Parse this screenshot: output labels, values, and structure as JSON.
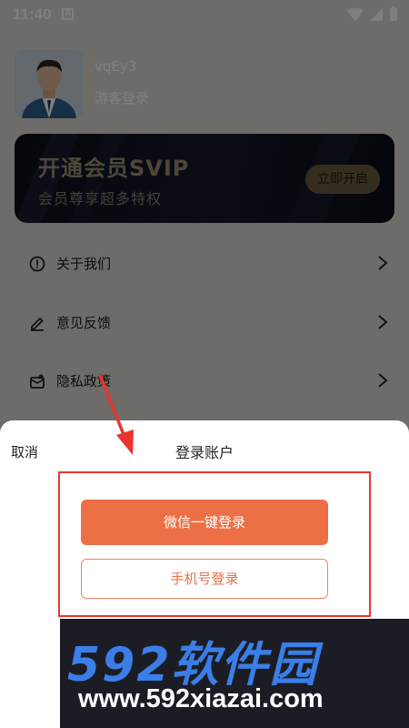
{
  "status": {
    "time": "11:40",
    "a_badge": "A"
  },
  "profile": {
    "username": "vqEy3",
    "usertype": "游客登录"
  },
  "vip": {
    "title": "开通会员SVIP",
    "subtitle": "会员尊享超多特权",
    "button": "立即开启"
  },
  "menu": [
    {
      "label": "关于我们",
      "icon": "alert-circle-icon"
    },
    {
      "label": "意见反馈",
      "icon": "edit-icon"
    },
    {
      "label": "隐私政策",
      "icon": "privacy-mail-icon"
    }
  ],
  "sheet": {
    "cancel": "取消",
    "title": "登录账户",
    "wechat_login": "微信一键登录",
    "phone_login": "手机号登录"
  },
  "watermark": {
    "brand": "592软件园",
    "url": "www.592xiazai.com"
  },
  "colors": {
    "accent": "#ed6f45",
    "highlight_box": "#e8352f",
    "vip_gold": "#9a8e77"
  }
}
